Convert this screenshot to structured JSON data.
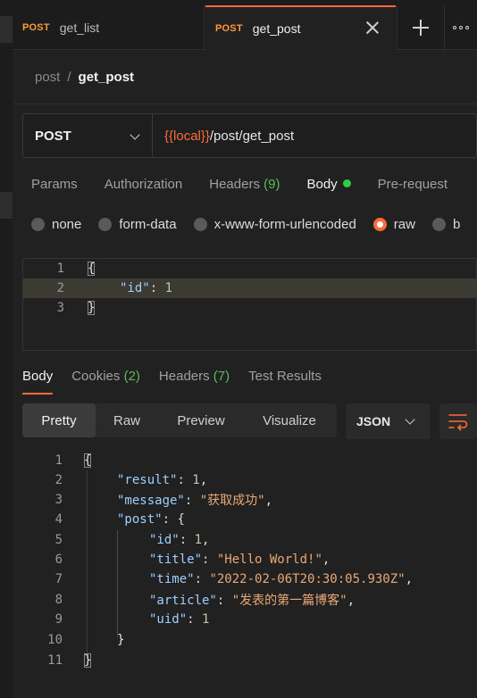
{
  "tabs": [
    {
      "method": "POST",
      "name": "get_list"
    },
    {
      "method": "POST",
      "name": "get_post"
    }
  ],
  "breadcrumb": {
    "parent": "post",
    "separator": "/",
    "current": "get_post"
  },
  "request": {
    "method": "POST",
    "url_variable": "{{local}}",
    "url_path": "/post/get_post"
  },
  "request_tabs": {
    "params": "Params",
    "authorization": "Authorization",
    "headers": "Headers",
    "headers_count": "(9)",
    "body": "Body",
    "pre_request": "Pre-request"
  },
  "body_modes": {
    "none": "none",
    "form_data": "form-data",
    "urlencoded": "x-www-form-urlencoded",
    "raw": "raw",
    "binary": "b",
    "selected": "raw"
  },
  "request_body": {
    "line_numbers": [
      "1",
      "2",
      "3"
    ],
    "open": "{",
    "key": "\"id\"",
    "colon": ": ",
    "value": "1",
    "close": "}"
  },
  "response_tabs": {
    "body": "Body",
    "cookies": "Cookies",
    "cookies_count": "(2)",
    "headers": "Headers",
    "headers_count": "(7)",
    "test_results": "Test Results"
  },
  "response_view": {
    "pretty": "Pretty",
    "raw": "Raw",
    "preview": "Preview",
    "visualize": "Visualize",
    "format": "JSON"
  },
  "response_body": {
    "line_numbers": [
      "1",
      "2",
      "3",
      "4",
      "5",
      "6",
      "7",
      "8",
      "9",
      "10",
      "11"
    ],
    "open": "{",
    "result_key": "\"result\"",
    "result_val": "1",
    "message_key": "\"message\"",
    "message_val": "\"获取成功\"",
    "post_key": "\"post\"",
    "post_open": "{",
    "id_key": "\"id\"",
    "id_val": "1",
    "title_key": "\"title\"",
    "title_val": "\"Hello World!\"",
    "time_key": "\"time\"",
    "time_val": "\"2022-02-06T20:30:05.930Z\"",
    "article_key": "\"article\"",
    "article_val": "\"发表的第一篇博客\"",
    "uid_key": "\"uid\"",
    "uid_val": "1",
    "post_close": "}",
    "close": "}"
  },
  "colors": {
    "accent": "#ff6c37",
    "method": "#ff9a3c",
    "count_green": "#5cb85c",
    "json_key": "#9ed0ff",
    "json_string": "#e9a876",
    "json_number": "#b5cea8"
  }
}
